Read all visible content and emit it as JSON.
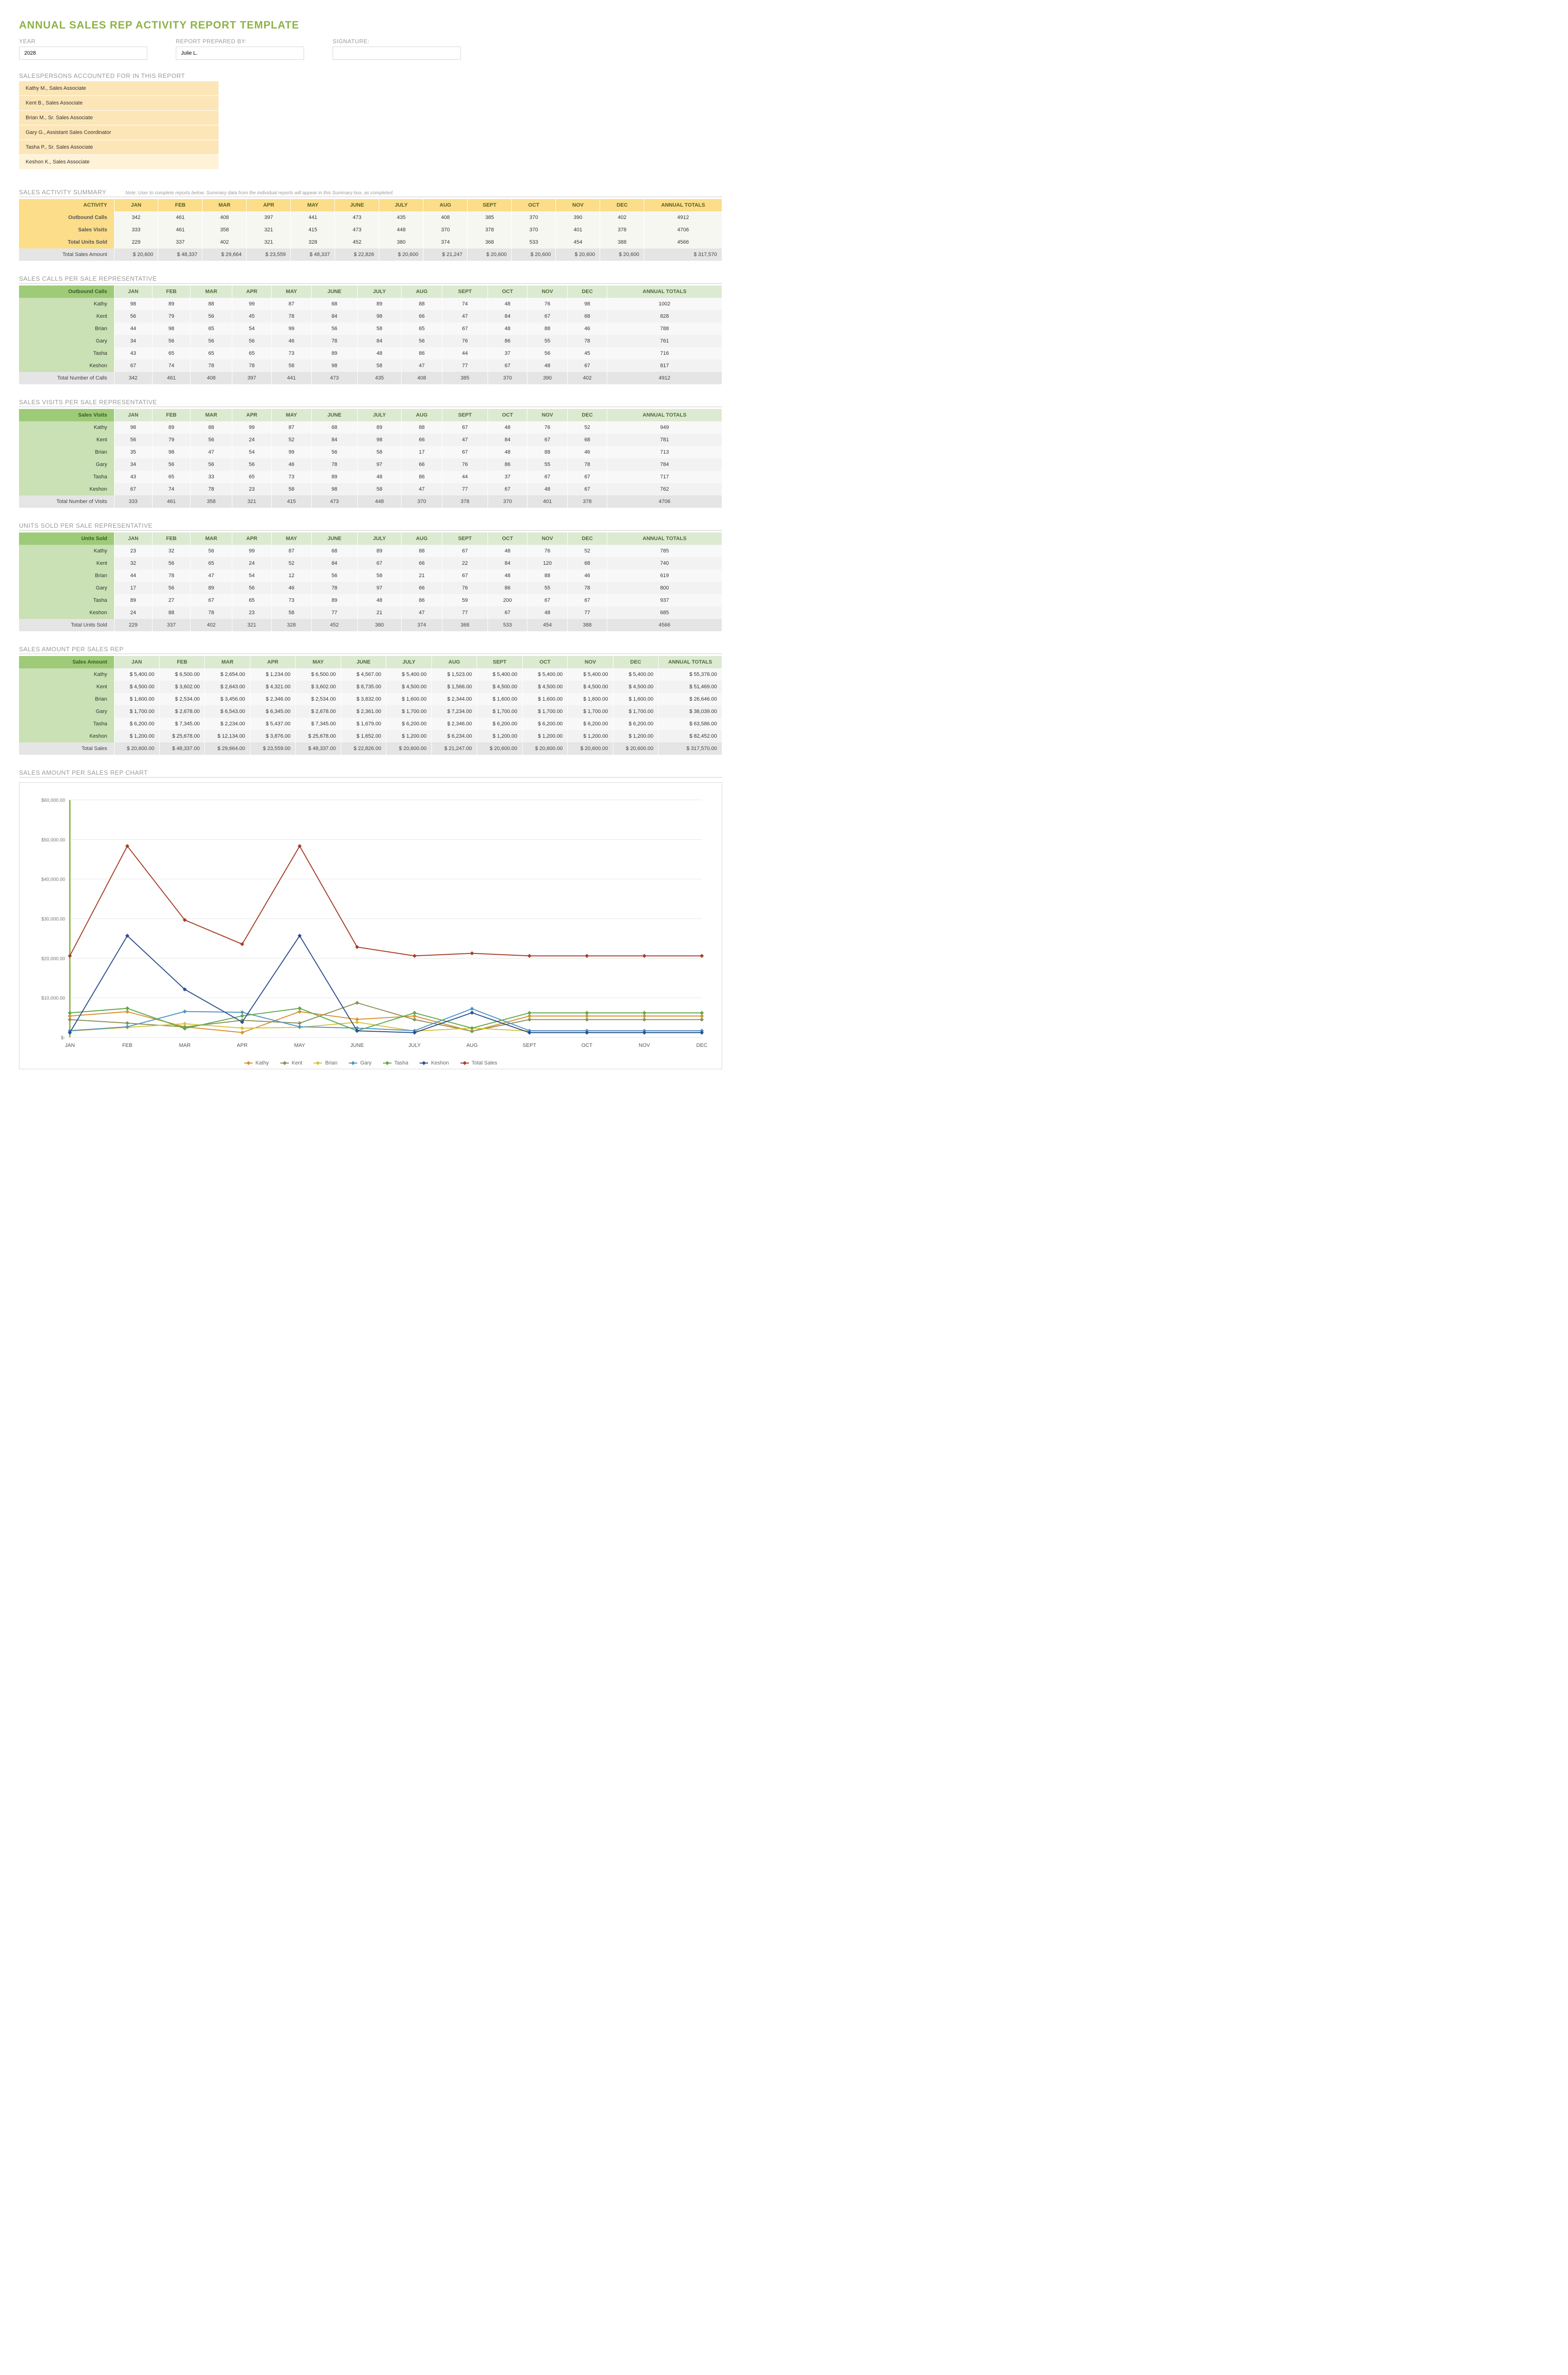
{
  "title": "ANNUAL SALES REP ACTIVITY REPORT TEMPLATE",
  "header": {
    "year_label": "YEAR",
    "year_value": "2028",
    "prepared_label": "REPORT PREPARED BY:",
    "prepared_value": "Julie L.",
    "signature_label": "SIGNATURE:",
    "signature_value": ""
  },
  "salespersons_label": "SALESPERSONS ACCOUNTED FOR IN THIS REPORT",
  "salespersons": [
    "Kathy M., Sales Associate",
    "Kent B., Sales Associate",
    "Brian M., Sr. Sales Associate",
    "Gary G., Assistant Sales Coordinator",
    "Tasha P., Sr. Sales Associate",
    "Keshon K., Sales Associate"
  ],
  "months": [
    "JAN",
    "FEB",
    "MAR",
    "APR",
    "MAY",
    "JUNE",
    "JULY",
    "AUG",
    "SEPT",
    "OCT",
    "NOV",
    "DEC"
  ],
  "annual_totals_label": "ANNUAL TOTALS",
  "summary": {
    "title": "SALES ACTIVITY SUMMARY",
    "note": "Note: User to complete reports below. Summary data from the individual reports will appear in this Summary box, as completed.",
    "activity_label": "ACTIVITY",
    "rows": [
      {
        "label": "Outbound Calls",
        "vals": [
          342,
          461,
          408,
          397,
          441,
          473,
          435,
          408,
          385,
          370,
          390,
          402
        ],
        "total": 4912
      },
      {
        "label": "Sales Visits",
        "vals": [
          333,
          461,
          358,
          321,
          415,
          473,
          448,
          370,
          378,
          370,
          401,
          378
        ],
        "total": 4706
      },
      {
        "label": "Total Units Sold",
        "vals": [
          229,
          337,
          402,
          321,
          328,
          452,
          380,
          374,
          368,
          533,
          454,
          388
        ],
        "total": 4566
      }
    ],
    "sales_amount_label": "Total Sales Amount",
    "sales_amount_vals": [
      "20,600",
      "48,337",
      "29,664",
      "23,559",
      "48,337",
      "22,826",
      "20,600",
      "21,247",
      "20,600",
      "20,600",
      "20,600",
      "20,600"
    ],
    "sales_amount_total": "317,570"
  },
  "calls": {
    "title": "SALES CALLS PER SALE REPRESENTATIVE",
    "header_label": "Outbound Calls",
    "reps": [
      {
        "name": "Kathy",
        "vals": [
          98,
          89,
          88,
          99,
          87,
          68,
          89,
          88,
          74,
          48,
          76,
          98
        ],
        "total": 1002
      },
      {
        "name": "Kent",
        "vals": [
          56,
          79,
          56,
          45,
          78,
          84,
          98,
          66,
          47,
          84,
          67,
          68
        ],
        "total": 828
      },
      {
        "name": "Brian",
        "vals": [
          44,
          98,
          65,
          54,
          99,
          56,
          58,
          65,
          67,
          48,
          88,
          46
        ],
        "total": 788
      },
      {
        "name": "Gary",
        "vals": [
          34,
          56,
          56,
          56,
          46,
          78,
          84,
          56,
          76,
          86,
          55,
          78
        ],
        "total": 761
      },
      {
        "name": "Tasha",
        "vals": [
          43,
          65,
          65,
          65,
          73,
          89,
          48,
          86,
          44,
          37,
          56,
          45
        ],
        "total": 716
      },
      {
        "name": "Keshon",
        "vals": [
          67,
          74,
          78,
          78,
          58,
          98,
          58,
          47,
          77,
          67,
          48,
          67
        ],
        "total": 817
      }
    ],
    "total_label": "Total Number of Calls",
    "totals": [
      342,
      461,
      408,
      397,
      441,
      473,
      435,
      408,
      385,
      370,
      390,
      402
    ],
    "grand_total": 4912
  },
  "visits": {
    "title": "SALES VISITS PER SALE REPRESENTATIVE",
    "header_label": "Sales Visits",
    "reps": [
      {
        "name": "Kathy",
        "vals": [
          98,
          89,
          88,
          99,
          87,
          68,
          89,
          88,
          67,
          48,
          76,
          52
        ],
        "total": 949
      },
      {
        "name": "Kent",
        "vals": [
          56,
          79,
          56,
          24,
          52,
          84,
          98,
          66,
          47,
          84,
          67,
          68
        ],
        "total": 781
      },
      {
        "name": "Brian",
        "vals": [
          35,
          98,
          47,
          54,
          99,
          56,
          58,
          17,
          67,
          48,
          88,
          46
        ],
        "total": 713
      },
      {
        "name": "Gary",
        "vals": [
          34,
          56,
          56,
          56,
          46,
          78,
          97,
          66,
          76,
          86,
          55,
          78
        ],
        "total": 784
      },
      {
        "name": "Tasha",
        "vals": [
          43,
          65,
          33,
          65,
          73,
          89,
          48,
          86,
          44,
          37,
          67,
          67
        ],
        "total": 717
      },
      {
        "name": "Keshon",
        "vals": [
          67,
          74,
          78,
          23,
          58,
          98,
          58,
          47,
          77,
          67,
          48,
          67
        ],
        "total": 762
      }
    ],
    "total_label": "Total Number of Visits",
    "totals": [
      333,
      461,
      358,
      321,
      415,
      473,
      448,
      370,
      378,
      370,
      401,
      378
    ],
    "grand_total": 4706
  },
  "units": {
    "title": "UNITS SOLD PER SALE REPRESENTATIVE",
    "header_label": "Units Sold",
    "reps": [
      {
        "name": "Kathy",
        "vals": [
          23,
          32,
          56,
          99,
          87,
          68,
          89,
          88,
          67,
          48,
          76,
          52
        ],
        "total": 785
      },
      {
        "name": "Kent",
        "vals": [
          32,
          56,
          65,
          24,
          52,
          84,
          67,
          66,
          22,
          84,
          120,
          68
        ],
        "total": 740
      },
      {
        "name": "Brian",
        "vals": [
          44,
          78,
          47,
          54,
          12,
          56,
          58,
          21,
          67,
          48,
          88,
          46
        ],
        "total": 619
      },
      {
        "name": "Gary",
        "vals": [
          17,
          56,
          89,
          56,
          46,
          78,
          97,
          66,
          76,
          86,
          55,
          78
        ],
        "total": 800
      },
      {
        "name": "Tasha",
        "vals": [
          89,
          27,
          67,
          65,
          73,
          89,
          48,
          86,
          59,
          200,
          67,
          67
        ],
        "total": 937
      },
      {
        "name": "Keshon",
        "vals": [
          24,
          88,
          78,
          23,
          58,
          77,
          21,
          47,
          77,
          67,
          48,
          77
        ],
        "total": 685
      }
    ],
    "total_label": "Total Units Sold",
    "totals": [
      229,
      337,
      402,
      321,
      328,
      452,
      380,
      374,
      368,
      533,
      454,
      388
    ],
    "grand_total": 4566
  },
  "amounts": {
    "title": "SALES AMOUNT PER SALES REP",
    "header_label": "Sales Amount",
    "reps": [
      {
        "name": "Kathy",
        "vals": [
          "5,400.00",
          "6,500.00",
          "2,654.00",
          "1,234.00",
          "6,500.00",
          "4,567.00",
          "5,400.00",
          "1,523.00",
          "5,400.00",
          "5,400.00",
          "5,400.00",
          "5,400.00"
        ],
        "total": "55,378.00"
      },
      {
        "name": "Kent",
        "vals": [
          "4,500.00",
          "3,602.00",
          "2,643.00",
          "4,321.00",
          "3,602.00",
          "8,735.00",
          "4,500.00",
          "1,566.00",
          "4,500.00",
          "4,500.00",
          "4,500.00",
          "4,500.00"
        ],
        "total": "51,469.00"
      },
      {
        "name": "Brian",
        "vals": [
          "1,600.00",
          "2,534.00",
          "3,456.00",
          "2,346.00",
          "2,534.00",
          "3,832.00",
          "1,600.00",
          "2,344.00",
          "1,600.00",
          "1,600.00",
          "1,600.00",
          "1,600.00"
        ],
        "total": "26,646.00"
      },
      {
        "name": "Gary",
        "vals": [
          "1,700.00",
          "2,678.00",
          "6,543.00",
          "6,345.00",
          "2,678.00",
          "2,361.00",
          "1,700.00",
          "7,234.00",
          "1,700.00",
          "1,700.00",
          "1,700.00",
          "1,700.00"
        ],
        "total": "38,039.00"
      },
      {
        "name": "Tasha",
        "vals": [
          "6,200.00",
          "7,345.00",
          "2,234.00",
          "5,437.00",
          "7,345.00",
          "1,679.00",
          "6,200.00",
          "2,346.00",
          "6,200.00",
          "6,200.00",
          "6,200.00",
          "6,200.00"
        ],
        "total": "63,586.00"
      },
      {
        "name": "Keshon",
        "vals": [
          "1,200.00",
          "25,678.00",
          "12,134.00",
          "3,876.00",
          "25,678.00",
          "1,652.00",
          "1,200.00",
          "6,234.00",
          "1,200.00",
          "1,200.00",
          "1,200.00",
          "1,200.00"
        ],
        "total": "82,452.00"
      }
    ],
    "total_label": "Total Sales",
    "totals": [
      "20,600.00",
      "48,337.00",
      "29,664.00",
      "23,559.00",
      "48,337.00",
      "22,826.00",
      "20,600.00",
      "21,247.00",
      "20,600.00",
      "20,600.00",
      "20,600.00",
      "20,600.00"
    ],
    "grand_total": "317,570.00"
  },
  "chart_title": "SALES AMOUNT PER SALES REP CHART",
  "chart_data": {
    "type": "line",
    "x": [
      "JAN",
      "FEB",
      "MAR",
      "APR",
      "MAY",
      "JUNE",
      "JULY",
      "AUG",
      "SEPT",
      "OCT",
      "NOV",
      "DEC"
    ],
    "ylim": [
      0,
      60000
    ],
    "yticks": [
      "$-",
      "$10,000.00",
      "$20,000.00",
      "$30,000.00",
      "$40,000.00",
      "$50,000.00",
      "$60,000.00"
    ],
    "series": [
      {
        "name": "Kathy",
        "color": "#d98f2e",
        "values": [
          5400,
          6500,
          2654,
          1234,
          6500,
          4567,
          5400,
          1523,
          5400,
          5400,
          5400,
          5400
        ]
      },
      {
        "name": "Kent",
        "color": "#8a8f55",
        "values": [
          4500,
          3602,
          2643,
          4321,
          3602,
          8735,
          4500,
          1566,
          4500,
          4500,
          4500,
          4500
        ]
      },
      {
        "name": "Brian",
        "color": "#d6c23e",
        "values": [
          1600,
          2534,
          3456,
          2346,
          2534,
          3832,
          1600,
          2344,
          1600,
          1600,
          1600,
          1600
        ]
      },
      {
        "name": "Gary",
        "color": "#4e94c1",
        "values": [
          1700,
          2678,
          6543,
          6345,
          2678,
          2361,
          1700,
          7234,
          1700,
          1700,
          1700,
          1700
        ]
      },
      {
        "name": "Tasha",
        "color": "#5aa84a",
        "values": [
          6200,
          7345,
          2234,
          5437,
          7345,
          1679,
          6200,
          2346,
          6200,
          6200,
          6200,
          6200
        ]
      },
      {
        "name": "Keshon",
        "color": "#2e4e90",
        "values": [
          1200,
          25678,
          12134,
          3876,
          25678,
          1652,
          1200,
          6234,
          1200,
          1200,
          1200,
          1200
        ]
      },
      {
        "name": "Total Sales",
        "color": "#a63e26",
        "values": [
          20600,
          48337,
          29664,
          23559,
          48337,
          22826,
          20600,
          21247,
          20600,
          20600,
          20600,
          20600
        ]
      }
    ]
  }
}
